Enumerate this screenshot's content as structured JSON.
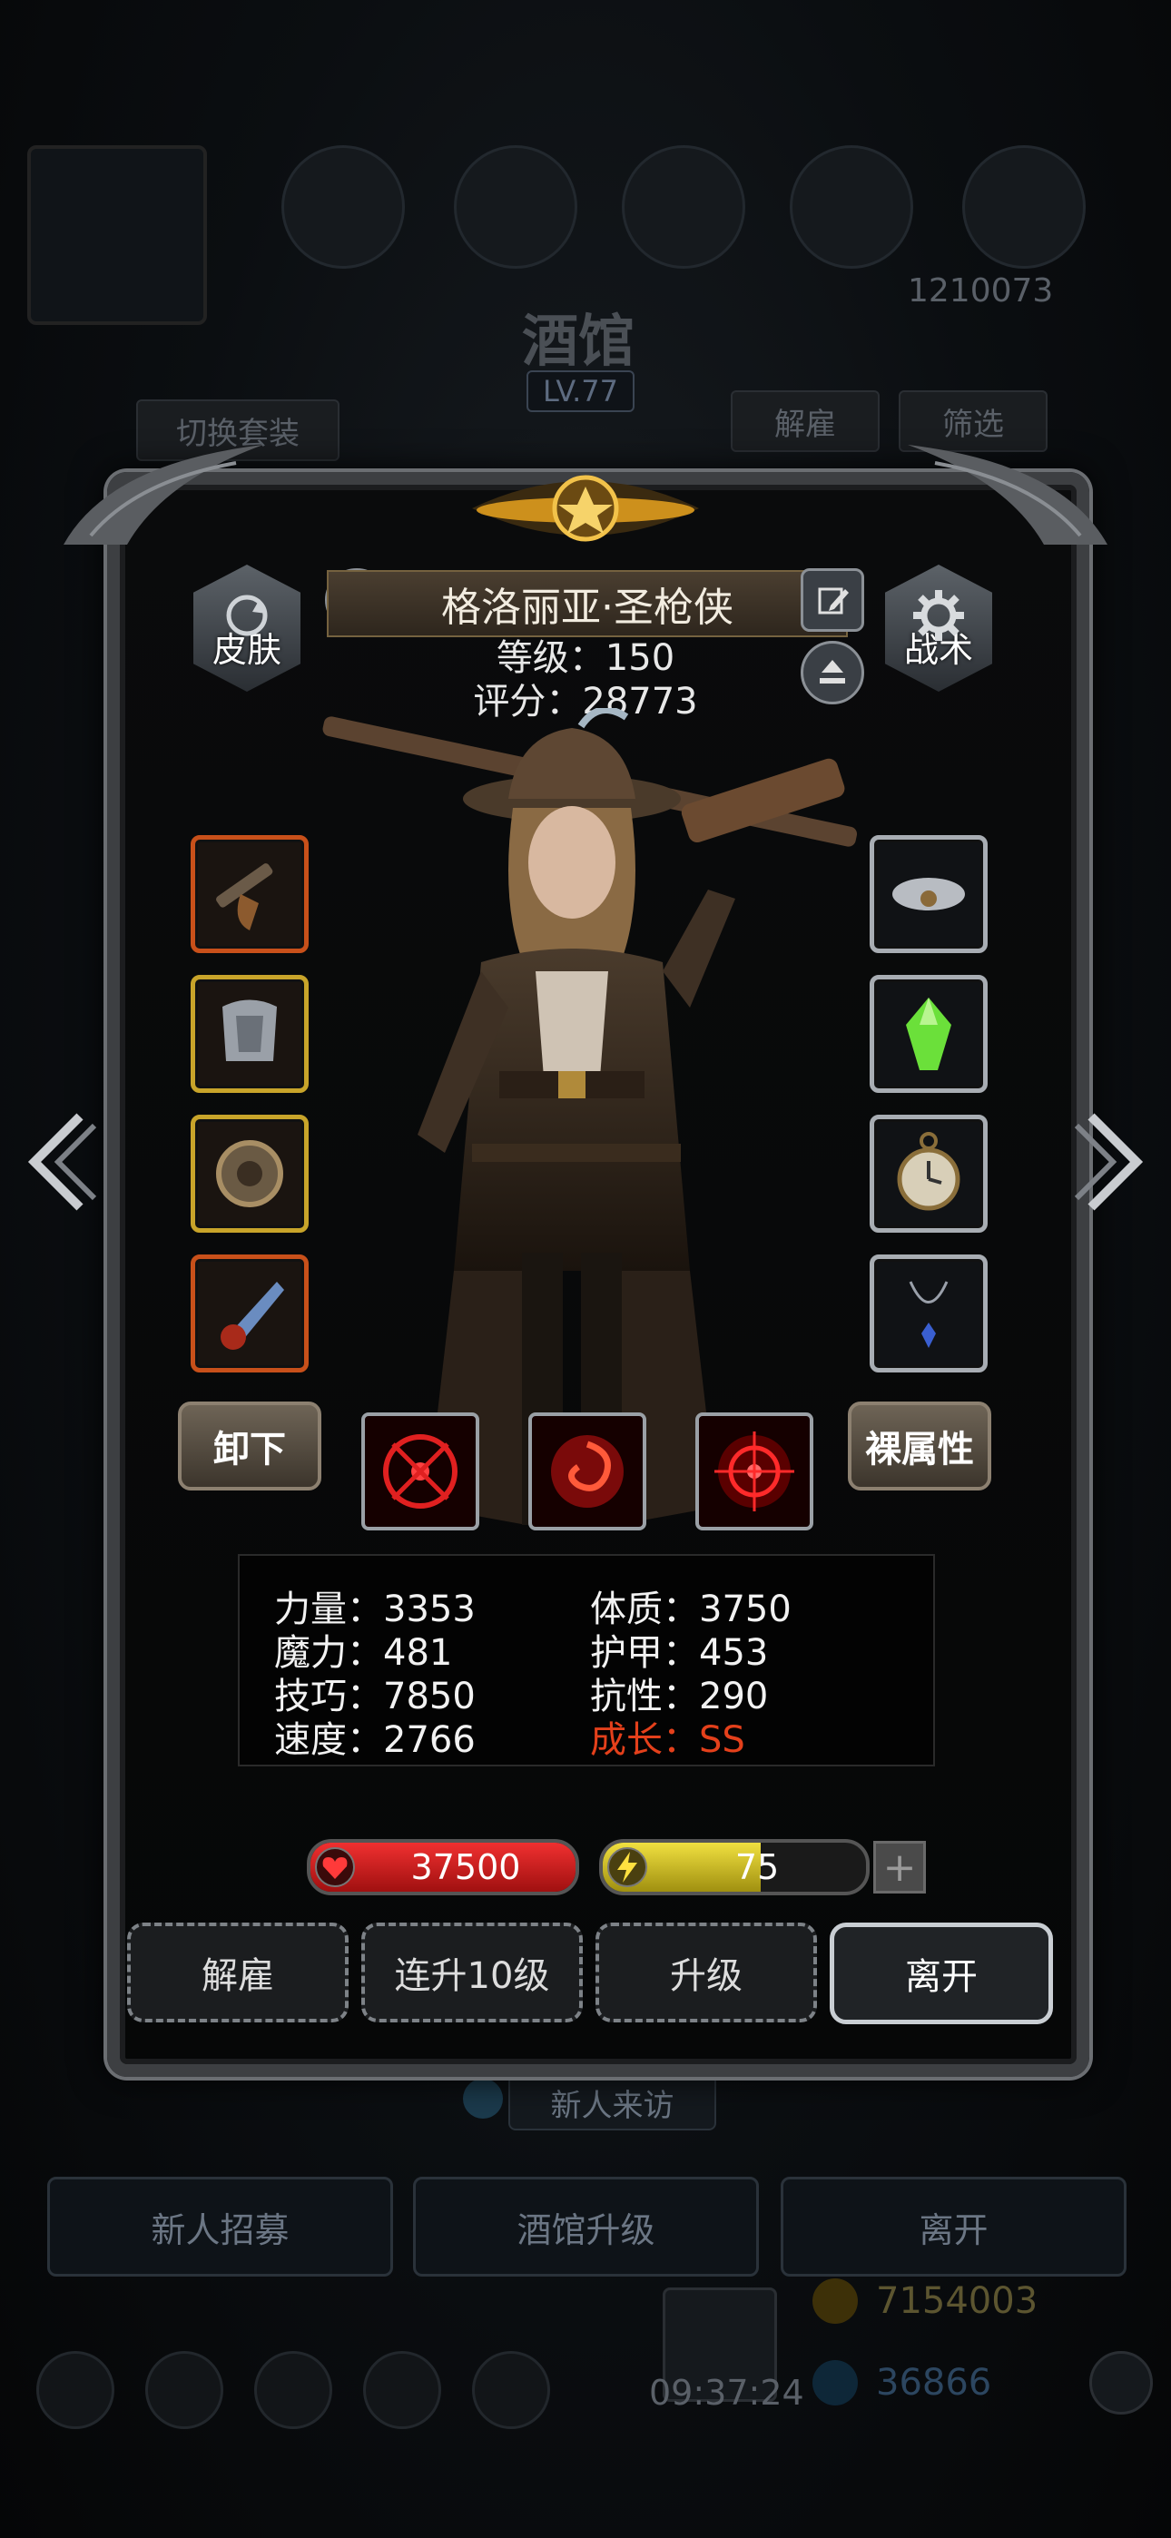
{
  "background": {
    "title": "酒馆",
    "level": "LV.77",
    "switch_outfit": "切换套装",
    "dismiss": "解雇",
    "filter": "筛选",
    "top_right_number": "1210073",
    "visitor": "新人来访",
    "bottom_buttons": [
      "新人招募",
      "酒馆升级",
      "离开"
    ],
    "gold": "7154003",
    "gems": "36866",
    "time": "09:37:24"
  },
  "hero": {
    "name": "格洛丽亚·圣枪侠",
    "level_line": "等级：150",
    "score_line": "评分：28773",
    "skin_label": "皮肤",
    "tactics_label": "战术"
  },
  "equipment_left": [
    {
      "icon": "flintlock-pistol-icon",
      "rarity": "orange"
    },
    {
      "icon": "armor-icon",
      "rarity": "gold"
    },
    {
      "icon": "ring-icon",
      "rarity": "gold"
    },
    {
      "icon": "horn-icon",
      "rarity": "orange"
    }
  ],
  "equipment_right": [
    {
      "icon": "cloud-amulet-icon",
      "rarity": "silver"
    },
    {
      "icon": "green-gem-icon",
      "rarity": "silver"
    },
    {
      "icon": "pocket-watch-icon",
      "rarity": "silver"
    },
    {
      "icon": "necklace-icon",
      "rarity": "silver"
    }
  ],
  "unequip_label": "卸下",
  "base_attr_label": "裸属性",
  "stats": {
    "strength": "力量：3353",
    "magic": "魔力：481",
    "skill": "技巧：7850",
    "speed": "速度：2766",
    "constitution": "体质：3750",
    "armor": "护甲：453",
    "resistance": "抗性：290",
    "growth": "成长：SS"
  },
  "hp": {
    "value": "37500",
    "fill": 1.0
  },
  "energy": {
    "value": "75",
    "fill": 0.6
  },
  "actions": [
    "解雇",
    "连升10级",
    "升级",
    "离开"
  ],
  "colors": {
    "growth": "#e4401b",
    "hp": "#d01f1f",
    "energy": "#d4c21e",
    "orange_rarity": "#c8501a",
    "gold_rarity": "#c8a42a"
  }
}
